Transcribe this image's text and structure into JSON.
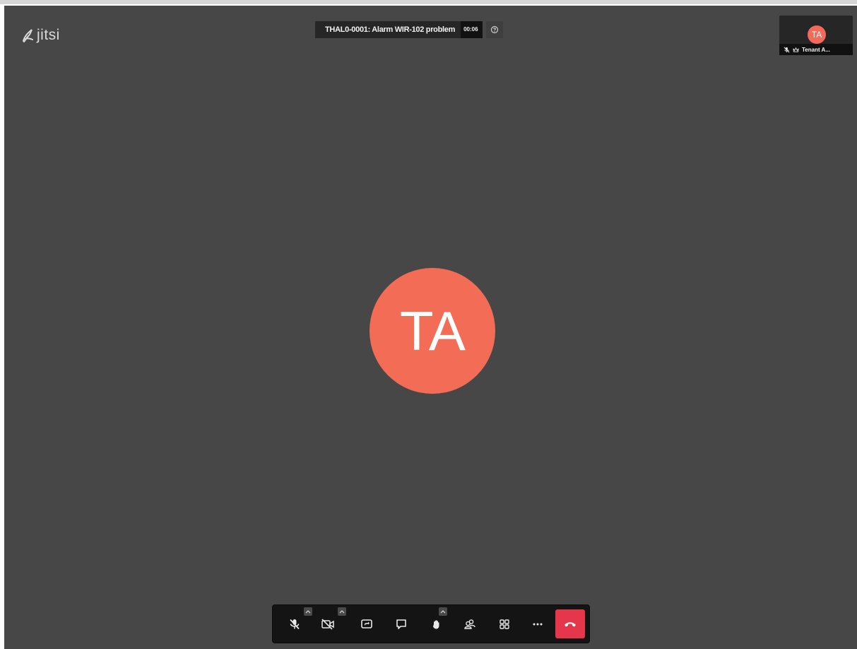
{
  "app": {
    "watermark_text": "jitsi",
    "background_color": "#474747"
  },
  "subject": {
    "title": "THAL0-0001: Alarm WIR-102 problem",
    "timer": "00:06",
    "help_icon": "question-icon"
  },
  "filmstrip": {
    "initials": "TA",
    "name": "Tenant A...",
    "avatar_color": "#f26b5a",
    "status_icons": [
      "mic-muted-icon",
      "moderator-crown-icon"
    ]
  },
  "main": {
    "avatar_initials": "TA",
    "avatar_color": "#f36d56"
  },
  "toolbar": {
    "buttons": [
      {
        "name": "microphone-muted-button",
        "icon": "mic-muted-icon",
        "has_menu": true
      },
      {
        "name": "camera-off-button",
        "icon": "camera-off-icon",
        "has_menu": true
      },
      {
        "name": "share-screen-button",
        "icon": "screen-share-icon",
        "has_menu": false
      },
      {
        "name": "chat-button",
        "icon": "chat-icon",
        "has_menu": false
      },
      {
        "name": "raise-hand-button",
        "icon": "hand-icon",
        "has_menu": true
      },
      {
        "name": "participants-button",
        "icon": "participants-icon",
        "has_menu": false
      },
      {
        "name": "tile-view-button",
        "icon": "tile-view-icon",
        "has_menu": false
      },
      {
        "name": "more-actions-button",
        "icon": "more-dots-icon",
        "has_menu": false
      }
    ],
    "hangup_icon": "hangup-icon",
    "hangup_color": "#e5364c"
  }
}
